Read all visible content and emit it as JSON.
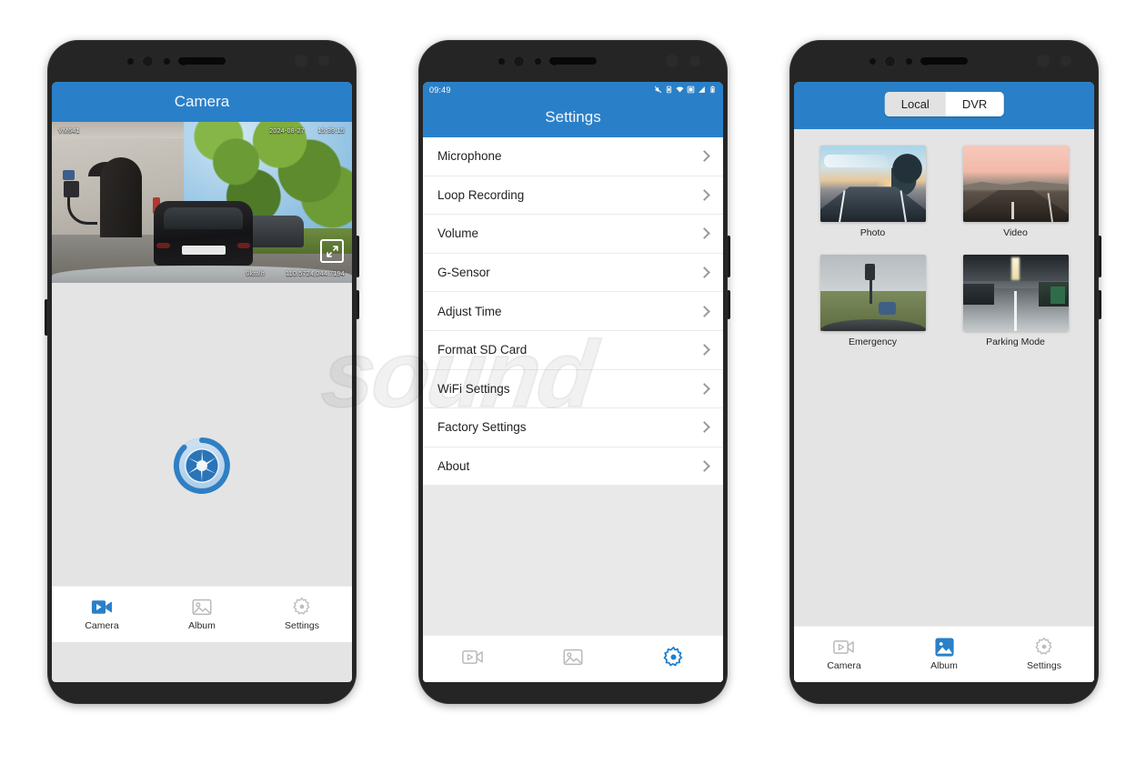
{
  "watermark": {
    "text": "sound"
  },
  "phones": {
    "camera": {
      "appbar_title": "Camera",
      "preview": {
        "model_label": "VM641",
        "date": "2024-08-27",
        "time": "15:39:15",
        "speed": "0km/h",
        "gps": "110.5724,044.7194",
        "expand_icon": "expand-arrows-icon"
      },
      "shutter_icon": "camera-aperture-icon",
      "tabs": [
        {
          "label": "Camera",
          "icon": "video-camera-icon",
          "active": true
        },
        {
          "label": "Album",
          "icon": "photo-image-icon",
          "active": false
        },
        {
          "label": "Settings",
          "icon": "gear-icon",
          "active": false
        }
      ]
    },
    "settings": {
      "statusbar": {
        "time": "09:49",
        "icons": [
          "mute-icon",
          "vibrate-icon",
          "wifi-icon",
          "sd-card-icon",
          "signal-icon",
          "battery-icon"
        ]
      },
      "appbar_title": "Settings",
      "items": [
        {
          "label": "Microphone",
          "chevron": "chevron-right-icon"
        },
        {
          "label": "Loop Recording",
          "chevron": "chevron-right-icon"
        },
        {
          "label": "Volume",
          "chevron": "chevron-right-icon"
        },
        {
          "label": "G-Sensor",
          "chevron": "chevron-right-icon"
        },
        {
          "label": "Adjust Time",
          "chevron": "chevron-right-icon"
        },
        {
          "label": "Format SD Card",
          "chevron": "chevron-right-icon"
        },
        {
          "label": "WiFi Settings",
          "chevron": "chevron-right-icon"
        },
        {
          "label": "Factory Settings",
          "chevron": "chevron-right-icon"
        },
        {
          "label": "About",
          "chevron": "chevron-right-icon"
        }
      ],
      "tabs": [
        {
          "label": "",
          "icon": "video-camera-icon",
          "active": false
        },
        {
          "label": "",
          "icon": "photo-image-icon",
          "active": false
        },
        {
          "label": "",
          "icon": "gear-icon",
          "active": true
        }
      ]
    },
    "album": {
      "segments": [
        {
          "label": "Local",
          "active": false
        },
        {
          "label": "DVR",
          "active": true
        }
      ],
      "cells": [
        {
          "label": "Photo",
          "art": "sunset-road-with-trees"
        },
        {
          "label": "Video",
          "art": "pink-sunset-highway"
        },
        {
          "label": "Emergency",
          "art": "cracked-windshield-road"
        },
        {
          "label": "Parking Mode",
          "art": "underground-parking-garage"
        }
      ],
      "tabs": [
        {
          "label": "Camera",
          "icon": "video-camera-icon",
          "active": false
        },
        {
          "label": "Album",
          "icon": "photo-image-icon",
          "active": true
        },
        {
          "label": "Settings",
          "icon": "gear-icon",
          "active": false
        }
      ]
    }
  },
  "colors": {
    "accent_blue": "#2a80c8",
    "screen_bg": "#e4e4e4",
    "tabbar_bg": "#ffffff",
    "phone_frame": "#252525"
  }
}
